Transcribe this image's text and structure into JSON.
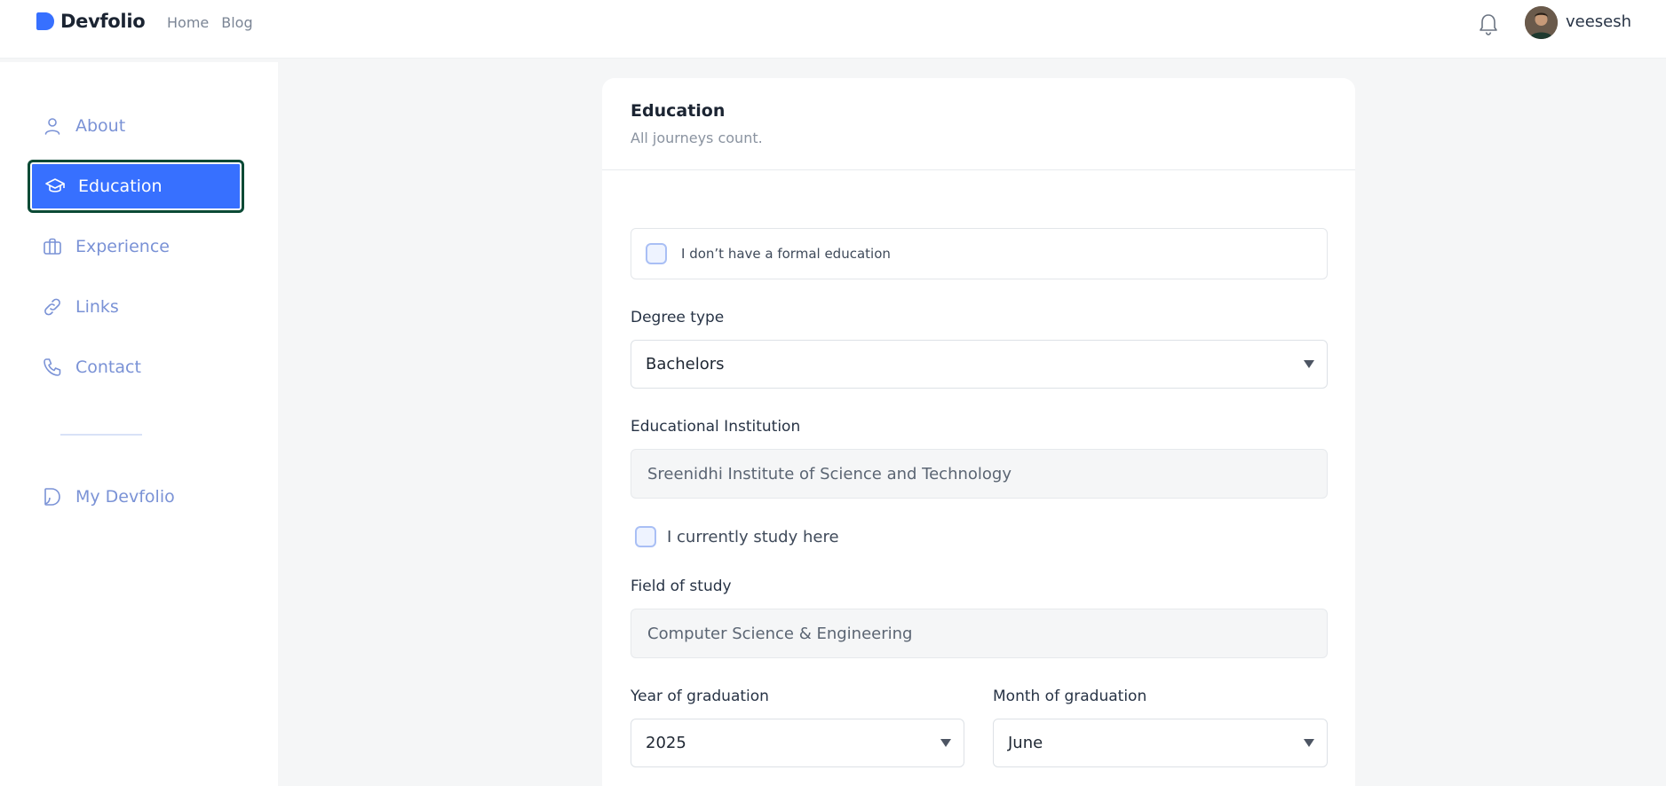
{
  "header": {
    "brand": "Devfolio",
    "nav": [
      "Home",
      "Blog"
    ],
    "username": "veesesh"
  },
  "sidebar": {
    "items": [
      {
        "label": "About",
        "icon": "user-icon"
      },
      {
        "label": "Education",
        "icon": "graduation-cap-icon",
        "active": true
      },
      {
        "label": "Experience",
        "icon": "briefcase-icon"
      },
      {
        "label": "Links",
        "icon": "link-icon"
      },
      {
        "label": "Contact",
        "icon": "phone-icon"
      }
    ],
    "footer_item": {
      "label": "My Devfolio",
      "icon": "devfolio-logo-icon"
    }
  },
  "card": {
    "title": "Education",
    "subtitle": "All journeys count."
  },
  "form": {
    "no_formal_label": "I don’t have a formal education",
    "degree_label": "Degree type",
    "degree_value": "Bachelors",
    "institution_label": "Educational Institution",
    "institution_value": "Sreenidhi Institute of Science and Technology",
    "currently_study_label": "I currently study here",
    "field_label": "Field of study",
    "field_value": "Computer Science & Engineering",
    "year_label": "Year of graduation",
    "year_value": "2025",
    "month_label": "Month of graduation",
    "month_value": "June"
  },
  "colors": {
    "accent": "#3770ff",
    "active_outline": "#0c4a35",
    "sidebar_text": "#7a92d6"
  }
}
